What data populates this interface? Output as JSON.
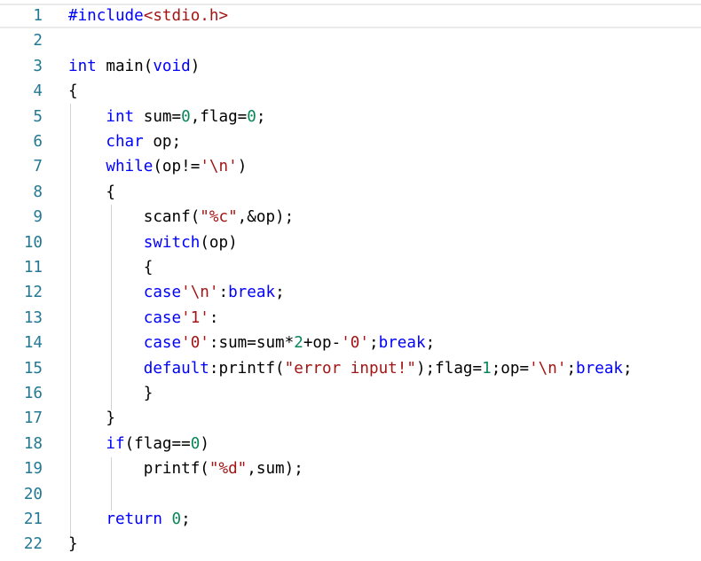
{
  "editor": {
    "lines": [
      {
        "n": "1",
        "tokens": [
          {
            "t": "#include",
            "c": "pp"
          },
          {
            "t": "<stdio.h>",
            "c": "inc"
          }
        ]
      },
      {
        "n": "2",
        "tokens": []
      },
      {
        "n": "3",
        "tokens": [
          {
            "t": "int",
            "c": "kw"
          },
          {
            "t": " main(",
            "c": ""
          },
          {
            "t": "void",
            "c": "kw"
          },
          {
            "t": ")",
            "c": ""
          }
        ]
      },
      {
        "n": "4",
        "tokens": [
          {
            "t": "{",
            "c": ""
          }
        ]
      },
      {
        "n": "5",
        "tokens": [
          {
            "t": "    ",
            "c": ""
          },
          {
            "t": "int",
            "c": "kw"
          },
          {
            "t": " sum=",
            "c": ""
          },
          {
            "t": "0",
            "c": "num"
          },
          {
            "t": ",flag=",
            "c": ""
          },
          {
            "t": "0",
            "c": "num"
          },
          {
            "t": ";",
            "c": ""
          }
        ]
      },
      {
        "n": "6",
        "tokens": [
          {
            "t": "    ",
            "c": ""
          },
          {
            "t": "char",
            "c": "kw"
          },
          {
            "t": " op;",
            "c": ""
          }
        ]
      },
      {
        "n": "7",
        "tokens": [
          {
            "t": "    ",
            "c": ""
          },
          {
            "t": "while",
            "c": "kw"
          },
          {
            "t": "(op!=",
            "c": ""
          },
          {
            "t": "'\\n'",
            "c": "str"
          },
          {
            "t": ")",
            "c": ""
          }
        ]
      },
      {
        "n": "8",
        "tokens": [
          {
            "t": "    {",
            "c": ""
          }
        ]
      },
      {
        "n": "9",
        "tokens": [
          {
            "t": "        scanf(",
            "c": ""
          },
          {
            "t": "\"%c\"",
            "c": "str"
          },
          {
            "t": ",&op);",
            "c": ""
          }
        ]
      },
      {
        "n": "10",
        "tokens": [
          {
            "t": "        ",
            "c": ""
          },
          {
            "t": "switch",
            "c": "kw"
          },
          {
            "t": "(op)",
            "c": ""
          }
        ]
      },
      {
        "n": "11",
        "tokens": [
          {
            "t": "        {",
            "c": ""
          }
        ]
      },
      {
        "n": "12",
        "tokens": [
          {
            "t": "        ",
            "c": ""
          },
          {
            "t": "case",
            "c": "kw"
          },
          {
            "t": "'\\n'",
            "c": "str"
          },
          {
            "t": ":",
            "c": ""
          },
          {
            "t": "break",
            "c": "kw"
          },
          {
            "t": ";",
            "c": ""
          }
        ]
      },
      {
        "n": "13",
        "tokens": [
          {
            "t": "        ",
            "c": ""
          },
          {
            "t": "case",
            "c": "kw"
          },
          {
            "t": "'1'",
            "c": "str"
          },
          {
            "t": ":",
            "c": ""
          }
        ]
      },
      {
        "n": "14",
        "tokens": [
          {
            "t": "        ",
            "c": ""
          },
          {
            "t": "case",
            "c": "kw"
          },
          {
            "t": "'0'",
            "c": "str"
          },
          {
            "t": ":sum=sum*",
            "c": ""
          },
          {
            "t": "2",
            "c": "num"
          },
          {
            "t": "+op-",
            "c": ""
          },
          {
            "t": "'0'",
            "c": "str"
          },
          {
            "t": ";",
            "c": ""
          },
          {
            "t": "break",
            "c": "kw"
          },
          {
            "t": ";",
            "c": ""
          }
        ]
      },
      {
        "n": "15",
        "tokens": [
          {
            "t": "        ",
            "c": ""
          },
          {
            "t": "default",
            "c": "kw"
          },
          {
            "t": ":printf(",
            "c": ""
          },
          {
            "t": "\"error input!\"",
            "c": "str"
          },
          {
            "t": ");flag=",
            "c": ""
          },
          {
            "t": "1",
            "c": "num"
          },
          {
            "t": ";op=",
            "c": ""
          },
          {
            "t": "'\\n'",
            "c": "str"
          },
          {
            "t": ";",
            "c": ""
          },
          {
            "t": "break",
            "c": "kw"
          },
          {
            "t": ";",
            "c": ""
          }
        ]
      },
      {
        "n": "16",
        "tokens": [
          {
            "t": "        }",
            "c": ""
          }
        ]
      },
      {
        "n": "17",
        "tokens": [
          {
            "t": "    }",
            "c": ""
          }
        ]
      },
      {
        "n": "18",
        "tokens": [
          {
            "t": "    ",
            "c": ""
          },
          {
            "t": "if",
            "c": "kw"
          },
          {
            "t": "(flag==",
            "c": ""
          },
          {
            "t": "0",
            "c": "num"
          },
          {
            "t": ")",
            "c": ""
          }
        ]
      },
      {
        "n": "19",
        "tokens": [
          {
            "t": "        printf(",
            "c": ""
          },
          {
            "t": "\"%d\"",
            "c": "str"
          },
          {
            "t": ",sum);",
            "c": ""
          }
        ]
      },
      {
        "n": "20",
        "tokens": []
      },
      {
        "n": "21",
        "tokens": [
          {
            "t": "    ",
            "c": ""
          },
          {
            "t": "return",
            "c": "kw"
          },
          {
            "t": " ",
            "c": ""
          },
          {
            "t": "0",
            "c": "num"
          },
          {
            "t": ";",
            "c": ""
          }
        ]
      },
      {
        "n": "22",
        "tokens": [
          {
            "t": "}",
            "c": ""
          }
        ]
      }
    ]
  },
  "colors": {
    "keyword": "#0000ff",
    "number": "#098658",
    "string": "#a31515",
    "line_number": "#237893",
    "indent_guide": "#d3d3d3"
  }
}
